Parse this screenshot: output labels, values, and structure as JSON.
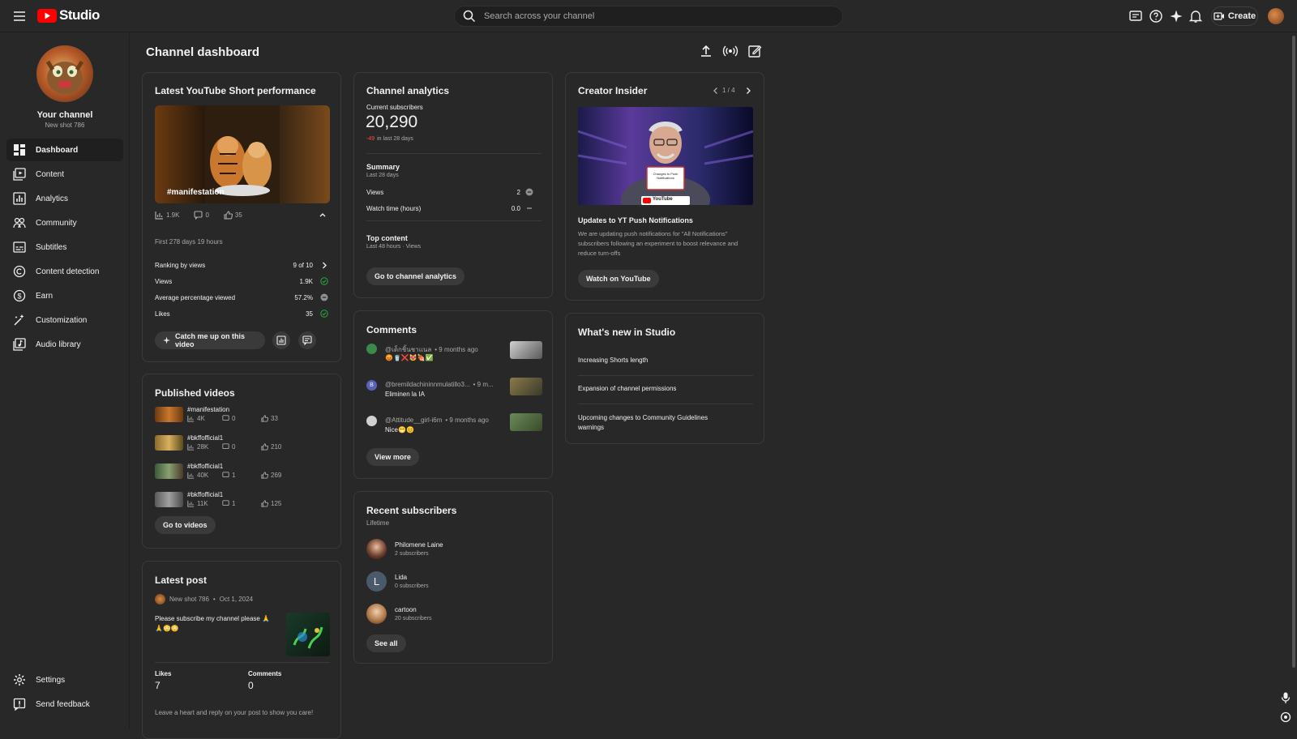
{
  "app": {
    "logo_text": "Studio"
  },
  "search": {
    "placeholder": "Search across your channel"
  },
  "header": {
    "create_label": "Create"
  },
  "sidebar": {
    "channel_name": "Your channel",
    "channel_handle": "New shot 786",
    "items": [
      {
        "label": "Dashboard",
        "icon": "dashboard-icon"
      },
      {
        "label": "Content",
        "icon": "content-icon"
      },
      {
        "label": "Analytics",
        "icon": "analytics-icon"
      },
      {
        "label": "Community",
        "icon": "community-icon"
      },
      {
        "label": "Subtitles",
        "icon": "subtitles-icon"
      },
      {
        "label": "Content detection",
        "icon": "copyright-icon"
      },
      {
        "label": "Earn",
        "icon": "earn-icon"
      },
      {
        "label": "Customization",
        "icon": "customization-icon"
      },
      {
        "label": "Audio library",
        "icon": "audio-library-icon"
      }
    ],
    "settings_label": "Settings",
    "feedback_label": "Send feedback"
  },
  "page": {
    "title": "Channel dashboard"
  },
  "short_perf": {
    "title": "Latest YouTube Short performance",
    "thumb_caption": "#manifestation",
    "views": "1.9K",
    "comments": "0",
    "likes": "35",
    "period": "First 278 days 19 hours",
    "rows": [
      {
        "label": "Ranking by views",
        "value": "9 of 10"
      },
      {
        "label": "Views",
        "value": "1.9K"
      },
      {
        "label": "Average percentage viewed",
        "value": "57.2%"
      },
      {
        "label": "Likes",
        "value": "35"
      }
    ],
    "catch_up_label": "Catch me up on this video"
  },
  "published": {
    "title": "Published videos",
    "videos": [
      {
        "title": "#manifestation",
        "views": "4K",
        "comments": "0",
        "likes": "33"
      },
      {
        "title": "#bkffofficial1",
        "views": "28K",
        "comments": "0",
        "likes": "210"
      },
      {
        "title": "#bkffofficial1",
        "views": "40K",
        "comments": "1",
        "likes": "269"
      },
      {
        "title": "#bkffofficial1",
        "views": "11K",
        "comments": "1",
        "likes": "125"
      }
    ],
    "button_label": "Go to videos"
  },
  "latest_post": {
    "title": "Latest post",
    "author": "New shot 786",
    "date": "Oct 1, 2024",
    "text": "Please subscribe my channel please 🙏",
    "emojis": "🙏😳😳",
    "likes_label": "Likes",
    "likes": "7",
    "comments_label": "Comments",
    "comments": "0",
    "footer": "Leave a heart and reply on your post to show you care!"
  },
  "analytics": {
    "title": "Channel analytics",
    "subs_label": "Current subscribers",
    "subs": "20,290",
    "change": "-49",
    "change_suffix": "in last 28 days",
    "summary_title": "Summary",
    "summary_period": "Last 28 days",
    "rows": [
      {
        "label": "Views",
        "value": "2"
      },
      {
        "label": "Watch time (hours)",
        "value": "0.0"
      }
    ],
    "top_title": "Top content",
    "top_period": "Last 48 hours · Views",
    "button_label": "Go to channel analytics"
  },
  "comments": {
    "title": "Comments",
    "items": [
      {
        "author": "@เด็กชิ้นชาแนล",
        "time": "• 9 months ago",
        "text": "😡🥤❌😻🍖✅"
      },
      {
        "author": "@bremildachininnmulatillo3...",
        "time": "• 9 m...",
        "text": "Eliminen la IA"
      },
      {
        "author": "@Attitude__girl-i6m",
        "time": "• 9 months ago",
        "text": "Nice😁😊"
      }
    ],
    "button_label": "View more"
  },
  "subscribers": {
    "title": "Recent subscribers",
    "period": "Lifetime",
    "items": [
      {
        "name": "Philomene Laine",
        "subs": "2 subscribers"
      },
      {
        "name": "Lida",
        "subs": "0 subscribers",
        "initial": "L"
      },
      {
        "name": "cartoon",
        "subs": "20 subscribers"
      }
    ],
    "button_label": "See all"
  },
  "creator_insider": {
    "title": "Creator Insider",
    "pager": "1 / 4",
    "video_title": "Updates to YT Push Notifications",
    "description": "We are updating push notifications for \"All Notifications\" subscribers following an experiment to boost relevance and reduce turn-offs",
    "sign_text": "Changes to Push Notifications",
    "yt_text": "YouTube",
    "button_label": "Watch on YouTube"
  },
  "whats_new": {
    "title": "What's new in Studio",
    "items": [
      "Increasing Shorts length",
      "Expansion of channel permissions",
      "Upcoming changes to Community Guidelines warnings"
    ]
  },
  "colors": {
    "accent": "#ff0000",
    "success": "#2ba640",
    "negative": "#ff4e45"
  }
}
